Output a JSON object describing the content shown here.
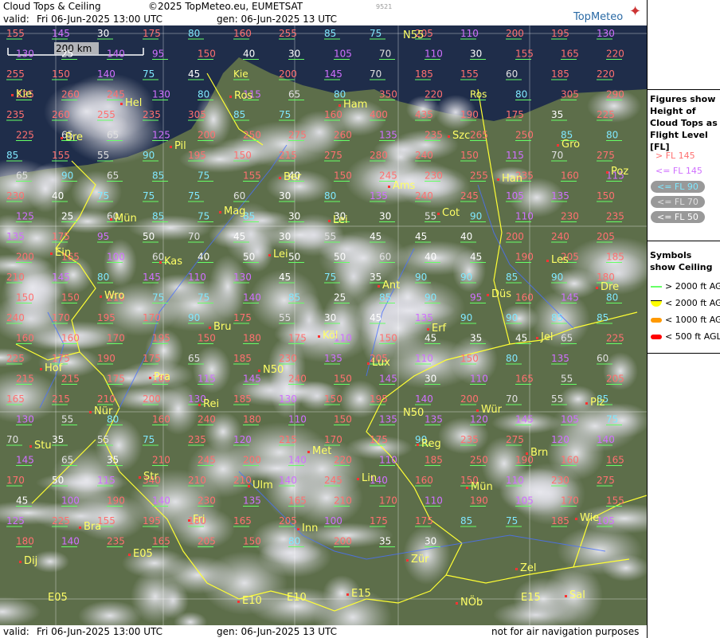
{
  "header": {
    "title": "Cloud Tops & Ceiling",
    "copyright": "©2025 TopMeteo.eu, EUMETSAT",
    "valid_label": "valid:",
    "valid_value": "Fri   06-Jun-2025  13:00 UTC",
    "gen": "gen: 06-Jun-2025 13 UTC",
    "frame_id": "9521",
    "logo": "TopMeteo"
  },
  "footer": {
    "valid_label": "valid:",
    "valid_value": "Fri   06-Jun-2025  13:00 UTC",
    "gen": "gen: 06-Jun-2025 13 UTC",
    "note": "not for air navigation purposes"
  },
  "map": {
    "scale_label": "200 km",
    "grid_labels": [
      "N55",
      "N50",
      "E05",
      "E10",
      "E15"
    ],
    "cities": [
      "Kie",
      "Hel",
      "Ros",
      "Ham",
      "Szc",
      "Gro",
      "Bre",
      "Pil",
      "Ber",
      "Ams",
      "Han",
      "Poz",
      "Mün",
      "Mag",
      "Lei",
      "Cot",
      "Les",
      "Ein",
      "Kas",
      "Lei",
      "Ant",
      "Düs",
      "Dre",
      "Wro",
      "Bru",
      "Köl",
      "Erf",
      "Jel",
      "Hof",
      "Pra",
      "N50",
      "Lux",
      "Wür",
      "Plz",
      "Nür",
      "Rei",
      "Met",
      "Reg",
      "Brn",
      "Stu",
      "Str",
      "Ulm",
      "Lin",
      "Mün",
      "Wie",
      "Bra",
      "Fri",
      "Inn",
      "Zür",
      "Zel",
      "Dij",
      "E05",
      "E10",
      "E15",
      "NÖb",
      "Sal"
    ],
    "tops_labels": [
      "155",
      "145",
      "30",
      "175",
      "80",
      "160",
      "255",
      "85",
      "75",
      "205",
      "110",
      "200",
      "195",
      "130",
      "130",
      "25",
      "140",
      "95",
      "150",
      "40",
      "30",
      "105",
      "70",
      "110",
      "30",
      "155",
      "165",
      "220",
      "255",
      "150",
      "140",
      "75",
      "45",
      "Kie",
      "200",
      "145",
      "70",
      "185",
      "155",
      "60",
      "185",
      "220",
      "225",
      "260",
      "245",
      "130",
      "80",
      "115",
      "65",
      "80",
      "350",
      "220",
      "Ros",
      "80",
      "305",
      "290",
      "235",
      "260",
      "255",
      "235",
      "305",
      "85",
      "75",
      "160",
      "400",
      "435",
      "190",
      "175",
      "35",
      "225",
      "225",
      "65",
      "65",
      "125",
      "200",
      "250",
      "275",
      "260",
      "135",
      "235",
      "265",
      "250",
      "85",
      "80",
      "85",
      "155",
      "55",
      "90",
      "195",
      "150",
      "215",
      "275",
      "280",
      "240",
      "150",
      "115",
      "70",
      "275",
      "65",
      "90",
      "65",
      "85",
      "75",
      "155",
      "40",
      "150",
      "245",
      "230",
      "255",
      "235",
      "160",
      "115",
      "230",
      "40",
      "75",
      "75",
      "75",
      "60",
      "30",
      "80",
      "135",
      "240",
      "245",
      "105",
      "135",
      "150",
      "125",
      "25",
      "60",
      "85",
      "75",
      "85",
      "30",
      "30",
      "30",
      "55",
      "90",
      "110",
      "230",
      "235",
      "135",
      "175",
      "95",
      "50",
      "70",
      "45",
      "30",
      "55",
      "45",
      "45",
      "40",
      "200",
      "240",
      "205",
      "200",
      "165",
      "100",
      "60",
      "40",
      "50",
      "50",
      "50",
      "60",
      "40",
      "45",
      "190",
      "205",
      "185",
      "210",
      "145",
      "80",
      "145",
      "110",
      "130",
      "45",
      "75",
      "35",
      "90",
      "90",
      "85",
      "90",
      "180",
      "150",
      "150",
      "210",
      "75",
      "75",
      "140",
      "85",
      "25",
      "85",
      "90",
      "95",
      "160",
      "145",
      "80",
      "240",
      "170",
      "195",
      "170",
      "90",
      "175",
      "55",
      "30",
      "45",
      "135",
      "90",
      "90",
      "85",
      "85",
      "160",
      "160",
      "170",
      "195",
      "150",
      "180",
      "175",
      "110",
      "150",
      "45",
      "35",
      "45",
      "65",
      "225",
      "225",
      "175",
      "190",
      "175",
      "65",
      "185",
      "230",
      "135",
      "205",
      "110",
      "150",
      "80",
      "135",
      "60",
      "215",
      "215",
      "175",
      "180",
      "115",
      "145",
      "240",
      "150",
      "145",
      "30",
      "110",
      "165",
      "55",
      "205",
      "165",
      "215",
      "210",
      "200",
      "130",
      "185",
      "130",
      "150",
      "195",
      "140",
      "200",
      "70",
      "55",
      "85",
      "130",
      "55",
      "80",
      "160",
      "240",
      "180",
      "110",
      "150",
      "135",
      "135",
      "120",
      "145",
      "105",
      "75",
      "70",
      "35",
      "55",
      "75",
      "235",
      "120",
      "215",
      "170",
      "175",
      "90",
      "235",
      "275",
      "120",
      "140",
      "145",
      "65",
      "35",
      "210",
      "245",
      "200",
      "140",
      "220",
      "110",
      "185",
      "250",
      "190",
      "160",
      "165",
      "170",
      "50",
      "115",
      "340",
      "210",
      "210",
      "140",
      "245",
      "140",
      "160",
      "150",
      "110",
      "230",
      "275",
      "45",
      "100",
      "190",
      "140",
      "230",
      "135",
      "165",
      "210",
      "170",
      "110",
      "190",
      "105",
      "170",
      "155",
      "125",
      "225",
      "155",
      "195",
      "180",
      "165",
      "205",
      "100",
      "175",
      "175",
      "85",
      "75",
      "185",
      "105",
      "180",
      "140",
      "235",
      "165",
      "205",
      "150",
      "80",
      "200",
      "35",
      "30"
    ],
    "legend_tops_colors": {
      "gt145": "#ff7070",
      "le145": "#d070ff",
      "le90": "#80e8ff",
      "le70": "#e0e0e0",
      "le50": "#ffffff"
    }
  },
  "legend": {
    "tops_title": "Figures show Height of Cloud Tops as Flight Level  [FL]",
    "tops_items": [
      "> FL 145",
      "<= FL 145",
      "<= FL 90",
      "<= FL 70",
      "<= FL 50"
    ],
    "ceiling_title": "Symbols show Ceiling",
    "ceiling_items": [
      "> 2000 ft AGL",
      "< 2000 ft AGL",
      "< 1000 ft AGL",
      "< 500 ft AGL"
    ],
    "ceiling_colors": [
      "#66ff66",
      "#ffff00",
      "#ff9900",
      "#ff0000"
    ]
  }
}
